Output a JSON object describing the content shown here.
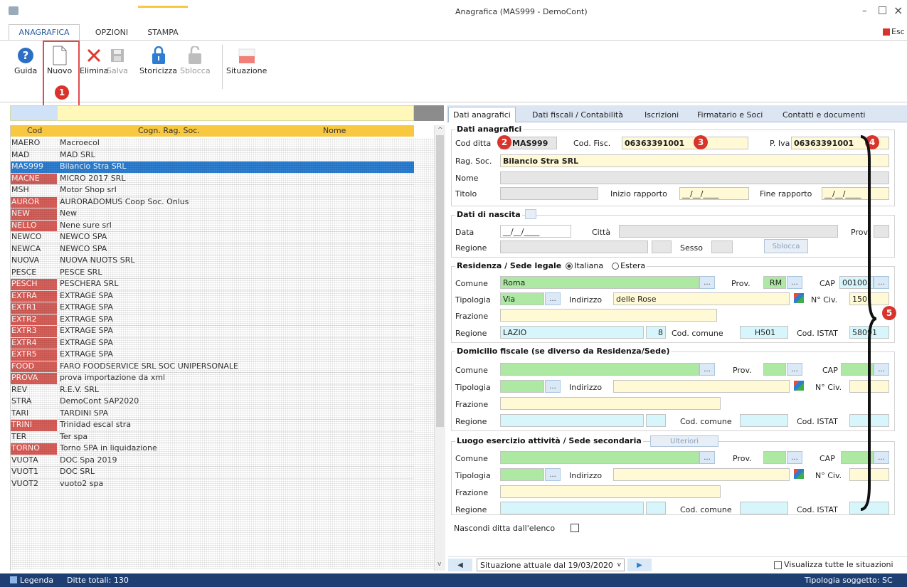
{
  "window": {
    "title": "Anagrafica (MAS999 - DemoCont)",
    "esc_label": "Esc",
    "minimize": "–",
    "maximize": "□",
    "close": "×"
  },
  "ribbon_tabs": [
    "ANAGRAFICA",
    "OPZIONI",
    "STAMPA"
  ],
  "toolbar": {
    "guida": "Guida",
    "nuovo": "Nuovo",
    "elimina": "Elimina",
    "salva": "Salva",
    "storicizza": "Storicizza",
    "sblocca": "Sblocca",
    "situazione": "Situazione"
  },
  "markers": [
    "1",
    "2",
    "3",
    "4",
    "5"
  ],
  "grid": {
    "headers": [
      "Cod",
      "Cogn. Rag. Soc.",
      "Nome"
    ],
    "rows": [
      [
        "MAERO",
        "Macroecol",
        ""
      ],
      [
        "MAD",
        "MAD SRL",
        ""
      ],
      [
        "MAS999",
        "Bilancio Stra SRL",
        ""
      ],
      [
        "MACNE",
        "MICRO 2017 SRL",
        ""
      ],
      [
        "MSH",
        "Motor Shop srl",
        ""
      ],
      [
        "AUROR",
        "AURORADOMUS Coop Soc. Onlus",
        ""
      ],
      [
        "NEW",
        "New",
        ""
      ],
      [
        "NELLO",
        "Nene sure srl",
        ""
      ],
      [
        "NEWCO",
        "NEWCO SPA",
        ""
      ],
      [
        "NEWCA",
        "NEWCO SPA",
        ""
      ],
      [
        "NUOVA",
        "NUOVA NUOTS SRL",
        ""
      ],
      [
        "PESCE",
        "PESCE SRL",
        ""
      ],
      [
        "PESCH",
        "PESCHERA SRL",
        ""
      ],
      [
        "EXTRA",
        "EXTRAGE SPA",
        ""
      ],
      [
        "EXTR1",
        "EXTRAGE SPA",
        ""
      ],
      [
        "EXTR2",
        "EXTRAGE SPA",
        ""
      ],
      [
        "EXTR3",
        "EXTRAGE SPA",
        ""
      ],
      [
        "EXTR4",
        "EXTRAGE SPA",
        ""
      ],
      [
        "EXTR5",
        "EXTRAGE SPA",
        ""
      ],
      [
        "FOOD",
        "FARO FOODSERVICE SRL SOC UNIPERSONALE",
        ""
      ],
      [
        "PROVA",
        "prova importazione da xml",
        ""
      ],
      [
        "REV",
        "R.E.V. SRL",
        ""
      ],
      [
        "STRA",
        "DemoCont SAP2020",
        ""
      ],
      [
        "TARI",
        "TARDINI SPA",
        ""
      ],
      [
        "TRINI",
        "Trinidad escal stra",
        ""
      ],
      [
        "TER",
        "Ter spa",
        ""
      ],
      [
        "TORNO",
        "Torno SPA in liquidazione",
        ""
      ],
      [
        "VUOTA",
        "DOC Spa 2019",
        ""
      ],
      [
        "VUOT1",
        "DOC SRL",
        ""
      ],
      [
        "VUOT2",
        "vuoto2 spa",
        ""
      ]
    ],
    "selected_row": 2
  },
  "footer": {
    "legenda": "Legenda",
    "ditte_totali": "Ditte totali: 130",
    "tipologia": "Tipologia soggetto: SC",
    "situazione": "Situazione attuale dal 19/03/2020",
    "visualizza": "Visualizza tutte le situazioni"
  },
  "form_tabs": [
    "Dati anagrafici",
    "Dati fiscali / Contabilità",
    "Iscrizioni",
    "Firmatario e Soci",
    "Contatti e documenti"
  ],
  "anagrafica": {
    "section": "Dati anagrafici",
    "cod_ditta_label": "Cod ditta",
    "cod_ditta": "MAS999",
    "cod_fisc_label": "Cod. Fisc.",
    "cod_fisc": "06363391001",
    "piva_label": "P. Iva",
    "piva": "06363391001",
    "ragsoc_label": "Rag. Soc.",
    "ragsoc": "Bilancio Stra SRL",
    "nome_label": "Nome",
    "titolo_label": "Titolo",
    "inizio_label": "Inizio rapporto",
    "fine_label": "Fine rapporto",
    "date_placeholder": "__/__/____"
  },
  "nascita": {
    "section": "Dati di nascita",
    "data_label": "Data",
    "citta_label": "Città",
    "prov_label": "Prov.",
    "regione_label": "Regione",
    "sesso_label": "Sesso",
    "sblocca": "Sblocca"
  },
  "residenza": {
    "section": "Residenza / Sede legale",
    "italiana": "Italiana",
    "estera": "Estera",
    "comune_label": "Comune",
    "comune": "Roma",
    "prov_label": "Prov.",
    "prov": "RM",
    "cap_label": "CAP",
    "cap": "00100",
    "tipologia_label": "Tipologia",
    "tipologia": "Via",
    "indirizzo_label": "Indirizzo",
    "indirizzo": "delle Rose",
    "nciv_label": "N° Civ.",
    "nciv": "150",
    "frazione_label": "Frazione",
    "regione_label": "Regione",
    "regione": "LAZIO",
    "regione_code": "8",
    "codcomune_label": "Cod. comune",
    "codcomune": "H501",
    "codistat_label": "Cod. ISTAT",
    "codistat": "58091"
  },
  "domicilio": {
    "section": "Domicilio fiscale (se diverso da Residenza/Sede)",
    "comune_label": "Comune",
    "prov_label": "Prov.",
    "cap_label": "CAP",
    "tipologia_label": "Tipologia",
    "indirizzo_label": "Indirizzo",
    "nciv_label": "N° Civ.",
    "frazione_label": "Frazione",
    "regione_label": "Regione",
    "codcomune_label": "Cod. comune",
    "codistat_label": "Cod. ISTAT"
  },
  "luogo": {
    "section": "Luogo esercizio attività / Sede secondaria",
    "ulteriori": "Ulteriori",
    "comune_label": "Comune",
    "prov_label": "Prov.",
    "cap_label": "CAP",
    "tipologia_label": "Tipologia",
    "indirizzo_label": "Indirizzo",
    "nciv_label": "N° Civ.",
    "frazione_label": "Frazione",
    "regione_label": "Regione",
    "codcomune_label": "Cod. comune",
    "codistat_label": "Cod. ISTAT"
  },
  "nascondi_label": "Nascondi ditta dall'elenco",
  "dots": "...",
  "colors": {
    "accent": "#2a5c9a",
    "selection": "#2f7fd0",
    "highlight_row": "#d9605a",
    "marker": "#d8342c",
    "grid_header": "#f8c840",
    "statusbar": "#1f3f73"
  }
}
